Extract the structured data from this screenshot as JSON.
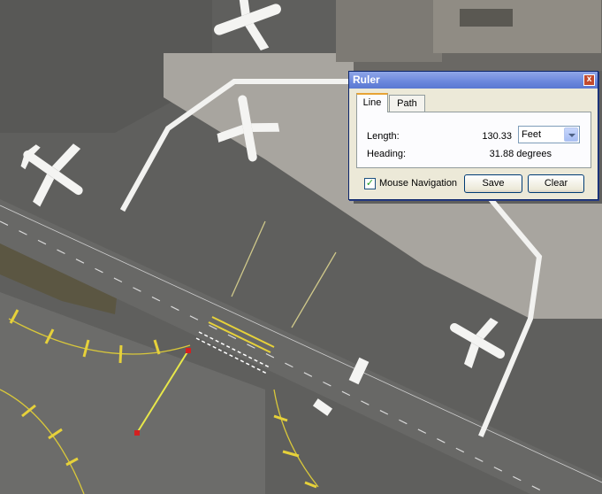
{
  "map": {
    "background": "#5f5f5d",
    "apron_color": "#a9a6a0"
  },
  "ruler": {
    "title": "Ruler",
    "close_label": "x",
    "tabs": [
      {
        "label": "Line",
        "active": true
      },
      {
        "label": "Path",
        "active": false
      }
    ],
    "length_label": "Length:",
    "length_value": "130.33",
    "unit_selected": "Feet",
    "heading_label": "Heading:",
    "heading_value": "31.88 degrees",
    "mouse_navigation_label": "Mouse Navigation",
    "mouse_navigation_checked": true,
    "save_label": "Save",
    "clear_label": "Clear"
  },
  "colors": {
    "measure_line": "#e8e84a",
    "endpoint": "#d42020",
    "title_bar": "#6b87dc"
  }
}
